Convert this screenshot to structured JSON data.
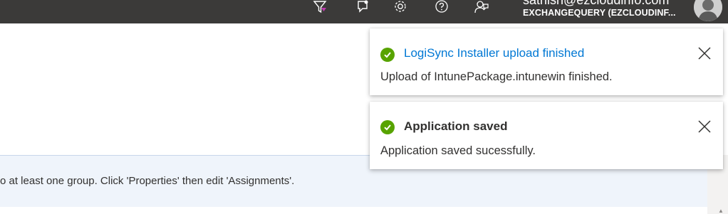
{
  "header": {
    "icons": [
      "funnel-icon",
      "notifications-icon",
      "settings-icon",
      "help-icon",
      "feedback-icon"
    ],
    "account_user": "sathish@ezcloudinfo.com",
    "account_tenant": "EXCHANGEQUERY (EZCLOUDINF..."
  },
  "info_bar": {
    "text": "o at least one group. Click 'Properties' then edit 'Assignments'."
  },
  "notifications": [
    {
      "title": "LogiSync Installer upload finished",
      "message": "Upload of IntunePackage.intunewin finished.",
      "status": "success"
    },
    {
      "title": "Application saved",
      "message": "Application saved sucessfully.",
      "status": "success"
    }
  ],
  "colors": {
    "topbar": "#3b3a39",
    "success": "#57a300",
    "link": "#0078d4",
    "info_bg": "#eff4fb"
  }
}
